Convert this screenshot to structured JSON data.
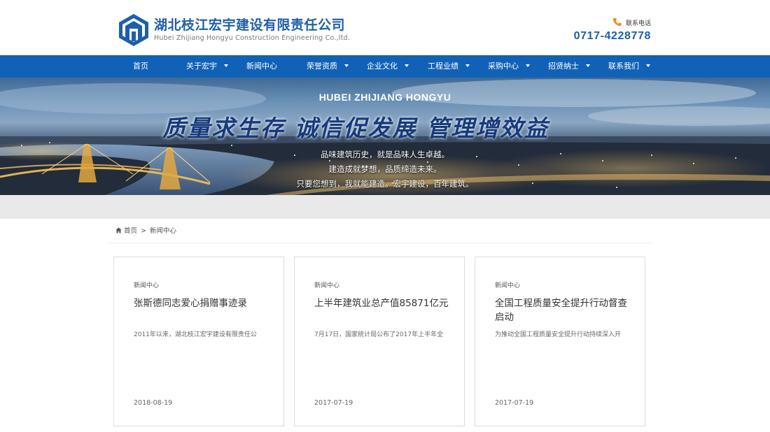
{
  "header": {
    "company_name": "湖北枝江宏宇建设有限责任公司",
    "company_name_en": "Hubei Zhijiang Hongyu Construction Engineering Co.,ltd.",
    "contact_label": "联系电话",
    "contact_number": "0717-4228778",
    "brand_color": "#1e5fa8",
    "phone_icon": "phone-icon"
  },
  "nav": {
    "background": "#1162b6",
    "items": [
      {
        "label": "首页",
        "has_dropdown": false
      },
      {
        "label": "关于宏宇",
        "has_dropdown": true
      },
      {
        "label": "新闻中心",
        "has_dropdown": false
      },
      {
        "label": "荣誉资质",
        "has_dropdown": true
      },
      {
        "label": "企业文化",
        "has_dropdown": true
      },
      {
        "label": "工程业绩",
        "has_dropdown": true
      },
      {
        "label": "采购中心",
        "has_dropdown": true
      },
      {
        "label": "招贤纳士",
        "has_dropdown": true
      },
      {
        "label": "联系我们",
        "has_dropdown": true
      }
    ]
  },
  "banner": {
    "title_en": "HUBEI ZHIJIANG HONGYU",
    "slogan": "质量求生存 诚信促发展 管理增效益",
    "lines": [
      "品味建筑历史，就是品味人生卓越。",
      "建造成就梦想，品质缔造未来。",
      "只要您想到，我就能建造。宏宇建设，百年建筑。"
    ]
  },
  "breadcrumb": {
    "home": "首页",
    "separator": ">",
    "current": "新闻中心"
  },
  "cards": [
    {
      "category": "新闻中心",
      "title": "张斯德同志爱心捐赠事迹录",
      "excerpt": "2011年以来，湖北枝江宏宇建设有限责任公",
      "date": "2018-08-19"
    },
    {
      "category": "新闻中心",
      "title": "上半年建筑业总产值85871亿元",
      "excerpt": "7月17日，国家统计局公布了2017年上半年全",
      "date": "2017-07-19"
    },
    {
      "category": "新闻中心",
      "title": "全国工程质量安全提升行动督查启动",
      "excerpt": "为推动全国工程质量安全提升行动持续深入开",
      "date": "2017-07-19"
    }
  ]
}
